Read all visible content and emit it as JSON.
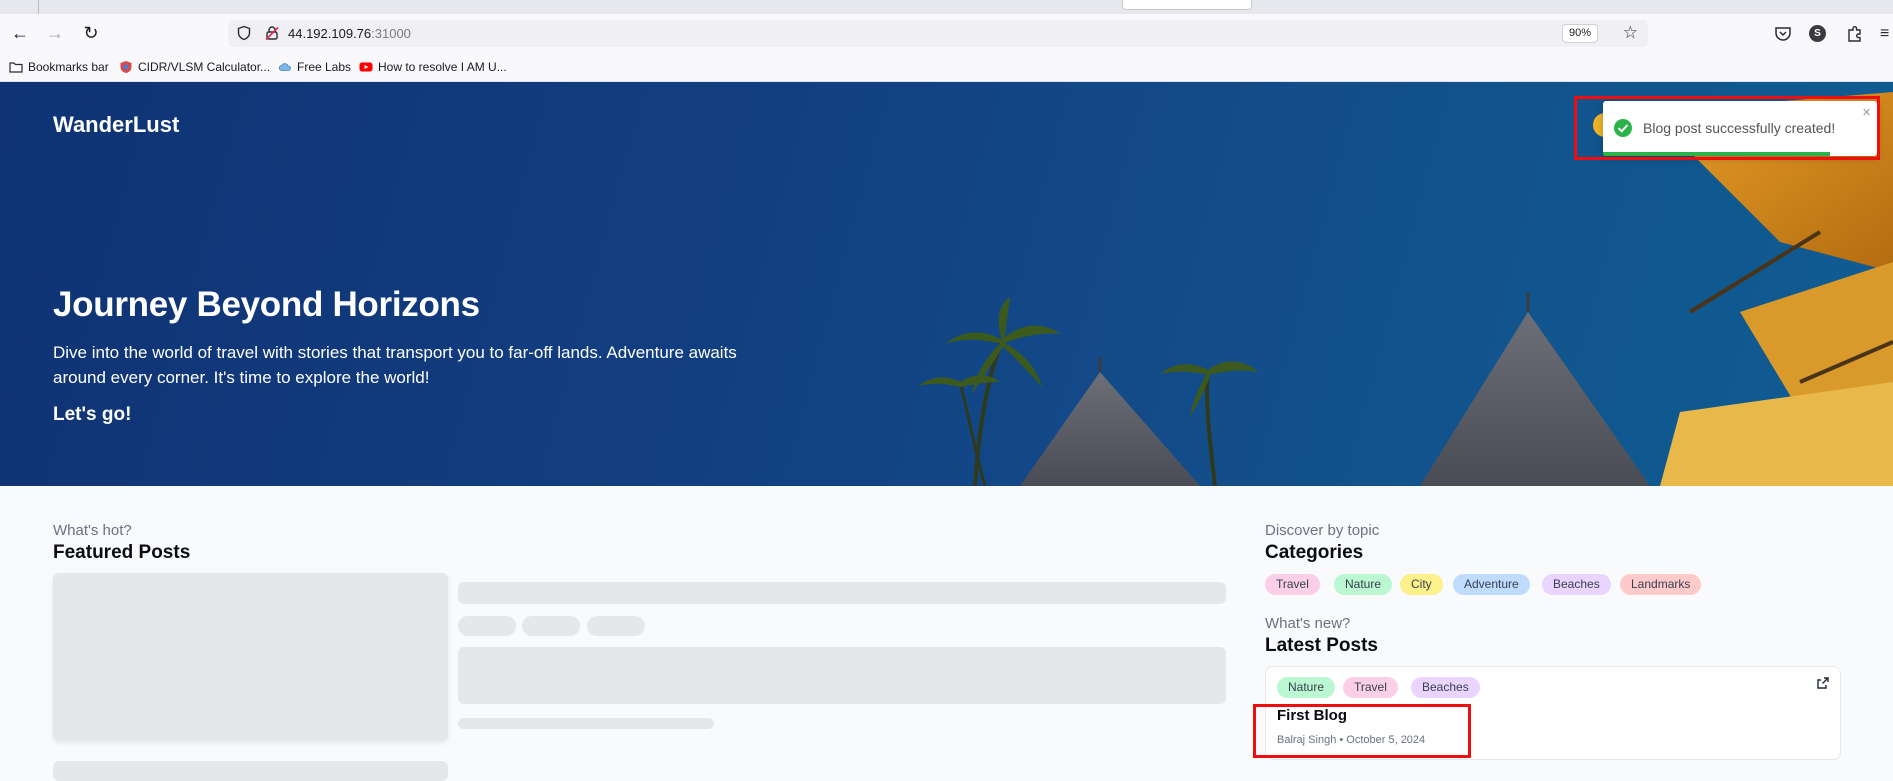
{
  "browser": {
    "url_host": "44.192.109.76",
    "url_port": ":31000",
    "zoom": "90%",
    "profile_initial": "S",
    "bookmarks": [
      {
        "label": "Bookmarks bar",
        "icon": "folder-icon"
      },
      {
        "label": "CIDR/VLSM Calculator...",
        "icon": "site-favicon"
      },
      {
        "label": "Free Labs",
        "icon": "cloud-favicon"
      },
      {
        "label": "How to resolve I AM U...",
        "icon": "youtube-icon"
      }
    ]
  },
  "site": {
    "brand": "WanderLust"
  },
  "hero": {
    "title": "Journey Beyond Horizons",
    "description": "Dive into the world of travel with stories that transport you to far-off lands. Adventure awaits around every corner. It's time to explore the world!",
    "cta": "Let's go!"
  },
  "toast": {
    "message": "Blog post successfully created!",
    "close": "×",
    "progress_fraction": 0.83
  },
  "featured": {
    "eyebrow": "What's hot?",
    "title": "Featured Posts"
  },
  "categories": {
    "eyebrow": "Discover by topic",
    "title": "Categories",
    "items": [
      {
        "label": "Travel",
        "color": "#fbcfe8"
      },
      {
        "label": "Nature",
        "color": "#bbf7d0"
      },
      {
        "label": "City",
        "color": "#fef08a"
      },
      {
        "label": "Adventure",
        "color": "#bfdbfe"
      },
      {
        "label": "Beaches",
        "color": "#e9d5ff"
      },
      {
        "label": "Landmarks",
        "color": "#fecaca"
      }
    ]
  },
  "latest": {
    "eyebrow": "What's new?",
    "title": "Latest Posts",
    "posts": [
      {
        "tags": [
          {
            "label": "Nature",
            "color": "#bbf7d0"
          },
          {
            "label": "Travel",
            "color": "#fbcfe8"
          },
          {
            "label": "Beaches",
            "color": "#e9d5ff"
          }
        ],
        "title": "First Blog",
        "meta": "Balraj Singh • October 5, 2024"
      }
    ]
  },
  "colors": {
    "highlight": "#ef0d0d",
    "toast_success": "#2ab34a"
  }
}
